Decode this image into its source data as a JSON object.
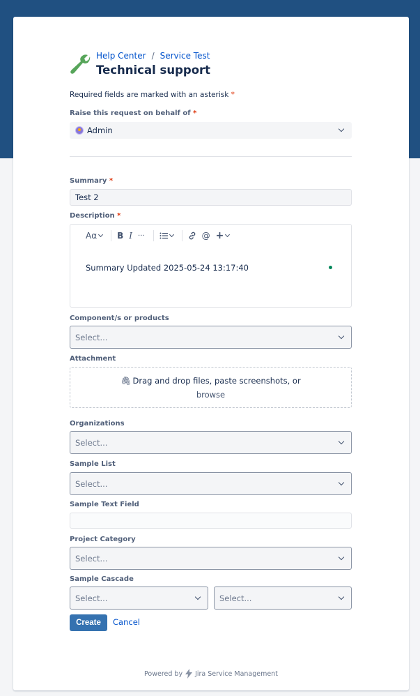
{
  "header": {
    "breadcrumbs": [
      "Help Center",
      "Service Test"
    ],
    "breadcrumb_separator": "/",
    "title": "Technical support"
  },
  "form": {
    "required_note": "Required fields are marked with an asterisk",
    "required_marker": "*",
    "on_behalf": {
      "label": "Raise this request on behalf of",
      "value": "Admin"
    },
    "summary": {
      "label": "Summary",
      "value": "Test 2"
    },
    "description": {
      "label": "Description",
      "toolbar": {
        "text_style": "Aα",
        "bold": "B",
        "italic": "I",
        "more": "···",
        "mention": "@",
        "insert": "+"
      },
      "content": "Summary Updated 2025-05-24 13:17:40"
    },
    "components": {
      "label": "Component/s or products",
      "placeholder": "Select..."
    },
    "attachment": {
      "label": "Attachment",
      "drop_text": "Drag and drop files, paste screenshots, or",
      "browse": "browse"
    },
    "organizations": {
      "label": "Organizations",
      "placeholder": "Select..."
    },
    "sample_list": {
      "label": "Sample List",
      "placeholder": "Select..."
    },
    "sample_text": {
      "label": "Sample Text Field",
      "value": ""
    },
    "project_category": {
      "label": "Project Category",
      "placeholder": "Select..."
    },
    "sample_cascade": {
      "label": "Sample Cascade",
      "placeholder_1": "Select...",
      "placeholder_2": "Select..."
    },
    "create_label": "Create",
    "cancel_label": "Cancel"
  },
  "footer": {
    "powered_by": "Powered by",
    "product": "Jira Service Management"
  },
  "colors": {
    "banner": "#205081",
    "primary_button": "#3572b0",
    "link": "#0052cc",
    "required": "#de350b",
    "logo": "#57a55a"
  },
  "icons": [
    "wrench-icon",
    "avatar-icon",
    "chevron-down-icon",
    "paperclip-icon",
    "link-icon",
    "list-icon",
    "jira-bolt-icon"
  ]
}
